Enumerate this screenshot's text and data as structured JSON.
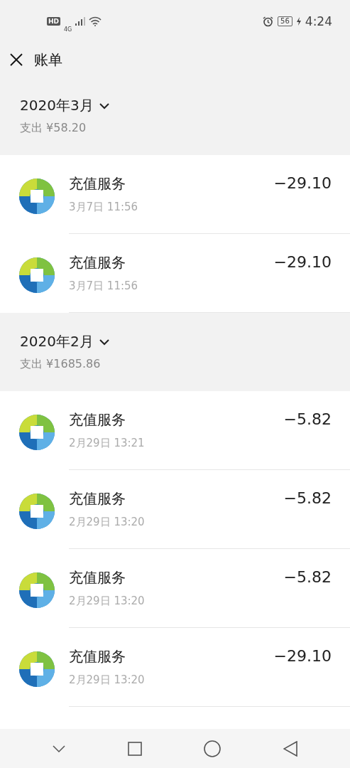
{
  "status_bar": {
    "hd": "HD",
    "network": "4G",
    "battery": "56",
    "time": "4:24"
  },
  "header": {
    "title": "账单"
  },
  "months": [
    {
      "title": "2020年3月",
      "expense": "支出 ¥58.20",
      "expanded": true,
      "items": [
        {
          "title": "充值服务",
          "date": "3月7日 11:56",
          "amount": "−29.10"
        },
        {
          "title": "充值服务",
          "date": "3月7日 11:56",
          "amount": "−29.10"
        }
      ]
    },
    {
      "title": "2020年2月",
      "expense": "支出 ¥1685.86",
      "expanded": true,
      "items": [
        {
          "title": "充值服务",
          "date": "2月29日 13:21",
          "amount": "−5.82"
        },
        {
          "title": "充值服务",
          "date": "2月29日 13:20",
          "amount": "−5.82"
        },
        {
          "title": "充值服务",
          "date": "2月29日 13:20",
          "amount": "−5.82"
        },
        {
          "title": "充值服务",
          "date": "2月29日 13:20",
          "amount": "−29.10"
        }
      ]
    }
  ]
}
